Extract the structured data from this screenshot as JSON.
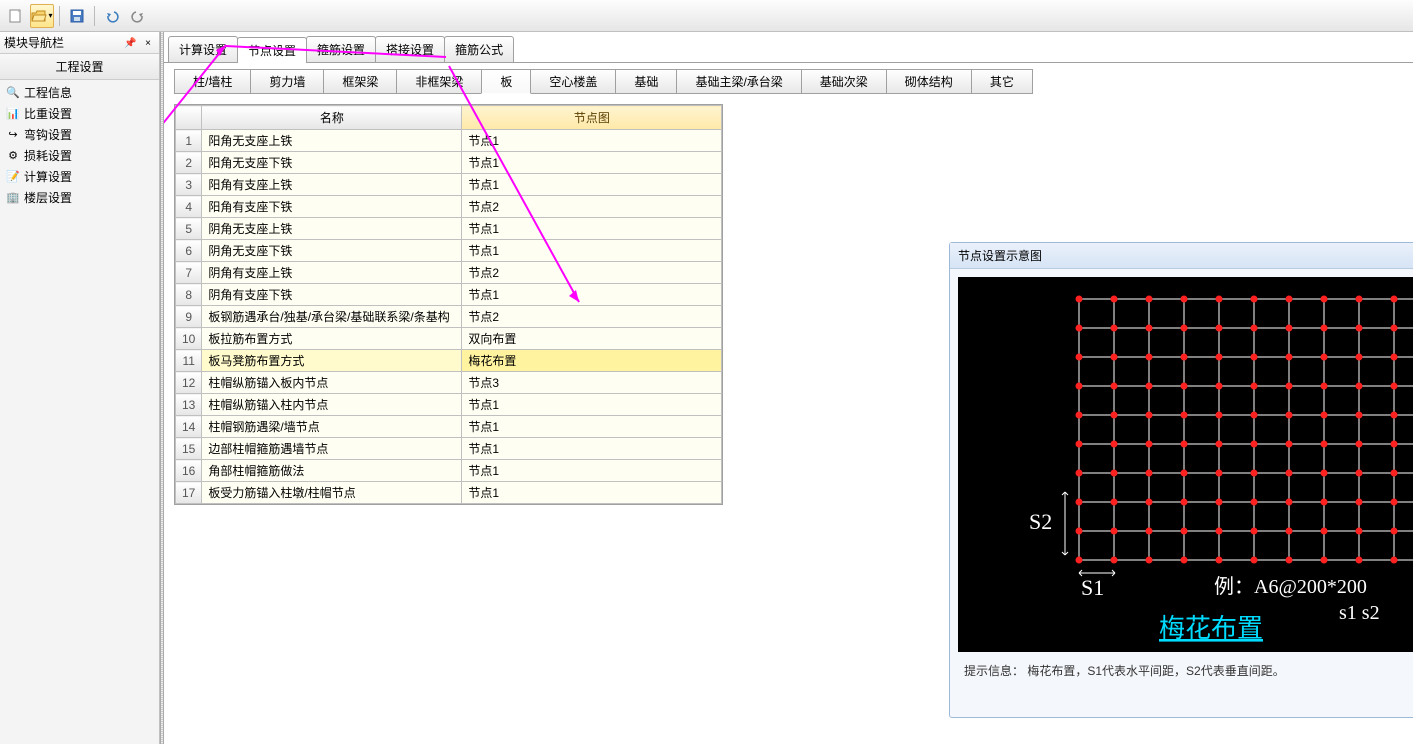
{
  "toolbar": {
    "new_tip": "新建",
    "open_tip": "打开",
    "save_tip": "保存",
    "undo_tip": "撤销",
    "redo_tip": "重做"
  },
  "sidebar": {
    "title": "模块导航栏",
    "header": "工程设置",
    "items": [
      {
        "label": "工程信息",
        "icon": "🔍"
      },
      {
        "label": "比重设置",
        "icon": "📊"
      },
      {
        "label": "弯钩设置",
        "icon": "↪"
      },
      {
        "label": "损耗设置",
        "icon": "⚙"
      },
      {
        "label": "计算设置",
        "icon": "📝"
      },
      {
        "label": "楼层设置",
        "icon": "🏢"
      }
    ]
  },
  "tabs": [
    {
      "label": "计算设置"
    },
    {
      "label": "节点设置",
      "active": true
    },
    {
      "label": "箍筋设置"
    },
    {
      "label": "搭接设置"
    },
    {
      "label": "箍筋公式"
    }
  ],
  "subtabs": [
    {
      "label": "柱/墙柱"
    },
    {
      "label": "剪力墙"
    },
    {
      "label": "框架梁"
    },
    {
      "label": "非框架梁"
    },
    {
      "label": "板",
      "active": true
    },
    {
      "label": "空心楼盖"
    },
    {
      "label": "基础"
    },
    {
      "label": "基础主梁/承台梁"
    },
    {
      "label": "基础次梁"
    },
    {
      "label": "砌体结构"
    },
    {
      "label": "其它"
    }
  ],
  "grid": {
    "headers": {
      "name": "名称",
      "node": "节点图"
    },
    "rows": [
      {
        "n": 1,
        "name": "阳角无支座上铁",
        "node": "节点1"
      },
      {
        "n": 2,
        "name": "阳角无支座下铁",
        "node": "节点1"
      },
      {
        "n": 3,
        "name": "阳角有支座上铁",
        "node": "节点1"
      },
      {
        "n": 4,
        "name": "阳角有支座下铁",
        "node": "节点2"
      },
      {
        "n": 5,
        "name": "阴角无支座上铁",
        "node": "节点1"
      },
      {
        "n": 6,
        "name": "阴角无支座下铁",
        "node": "节点1"
      },
      {
        "n": 7,
        "name": "阴角有支座上铁",
        "node": "节点2"
      },
      {
        "n": 8,
        "name": "阴角有支座下铁",
        "node": "节点1"
      },
      {
        "n": 9,
        "name": "板钢筋遇承台/独基/承台梁/基础联系梁/条基构",
        "node": "节点2"
      },
      {
        "n": 10,
        "name": "板拉筋布置方式",
        "node": "双向布置"
      },
      {
        "n": 11,
        "name": "板马凳筋布置方式",
        "node": "梅花布置",
        "hl": true
      },
      {
        "n": 12,
        "name": "柱帽纵筋锚入板内节点",
        "node": "节点3"
      },
      {
        "n": 13,
        "name": "柱帽纵筋锚入柱内节点",
        "node": "节点1"
      },
      {
        "n": 14,
        "name": "柱帽钢筋遇梁/墙节点",
        "node": "节点1"
      },
      {
        "n": 15,
        "name": "边部柱帽箍筋遇墙节点",
        "node": "节点1"
      },
      {
        "n": 16,
        "name": "角部柱帽箍筋做法",
        "node": "节点1"
      },
      {
        "n": 17,
        "name": "板受力筋锚入柱墩/柱帽节点",
        "node": "节点1"
      }
    ]
  },
  "preview": {
    "title": "节点设置示意图",
    "s1": "S1",
    "s2": "S2",
    "example": "例：A6@200*200",
    "sub": "s1   s2",
    "caption": "梅花布置",
    "hint": "提示信息： 梅花布置，S1代表水平间距，S2代表垂直间距。"
  }
}
